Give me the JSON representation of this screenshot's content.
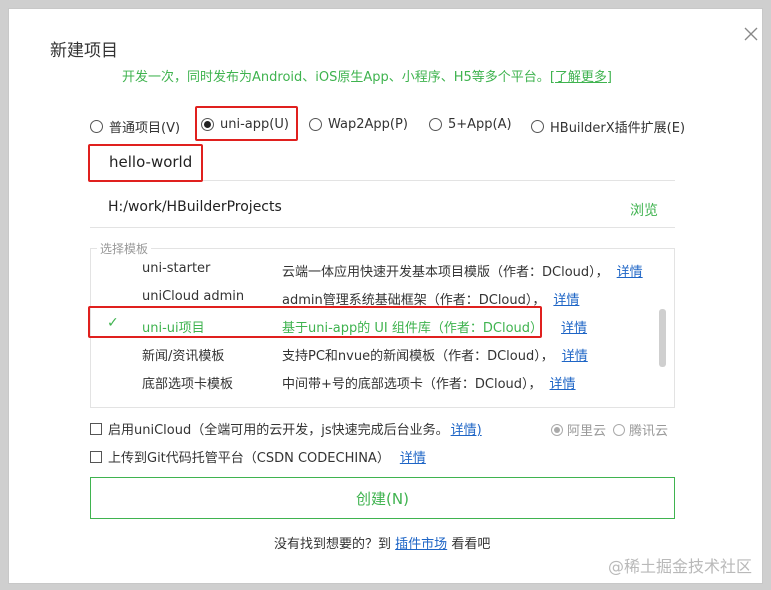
{
  "dialog": {
    "title": "新建项目",
    "subtitle": "开发一次，同时发布为Android、iOS原生App、小程序、H5等多个平台。",
    "learn_more": "[了解更多]"
  },
  "project_types": [
    {
      "label": "普通项目(V)",
      "selected": false
    },
    {
      "label": "uni-app(U)",
      "selected": true
    },
    {
      "label": "Wap2App(P)",
      "selected": false
    },
    {
      "label": "5+App(A)",
      "selected": false
    },
    {
      "label": "HBuilderX插件扩展(E)",
      "selected": false
    }
  ],
  "project_name": "hello-world",
  "location": "H:/work/HBuilderProjects",
  "browse_label": "浏览",
  "templates": {
    "legend": "选择模板",
    "items": [
      {
        "name": "uni-starter",
        "desc": "云端一体应用快速开发基本项目模版（作者：DCloud），",
        "detail": "详情",
        "selected": false
      },
      {
        "name": "uniCloud admin",
        "desc": "admin管理系统基础框架（作者：DCloud），",
        "detail": "详情",
        "selected": false
      },
      {
        "name": "uni-ui项目",
        "desc": "基于uni-app的 UI 组件库（作者：DCloud）",
        "detail": "详情",
        "selected": true
      },
      {
        "name": "新闻/资讯模板",
        "desc": "支持PC和nvue的新闻模板（作者：DCloud），",
        "detail": "详情",
        "selected": false
      },
      {
        "name": "底部选项卡模板",
        "desc": "中间带+号的底部选项卡（作者：DCloud），",
        "detail": "详情",
        "selected": false
      }
    ]
  },
  "unicloud": {
    "label": "启用uniCloud（全端可用的云开发，js快速完成后台业务。",
    "detail": "详情)",
    "providers": [
      {
        "label": "阿里云",
        "selected": true
      },
      {
        "label": "腾讯云",
        "selected": false
      }
    ]
  },
  "git": {
    "label": "上传到Git代码托管平台（CSDN CODECHINA）",
    "detail": "详情"
  },
  "create_label": "创建(N)",
  "footer": {
    "prefix": "没有找到想要的？到",
    "link": "插件市场",
    "suffix": "看看吧"
  },
  "watermark": "@稀土掘金技术社区",
  "colors": {
    "accent": "#3fb34f",
    "link": "#1e65c6",
    "highlight": "#e0201e"
  }
}
